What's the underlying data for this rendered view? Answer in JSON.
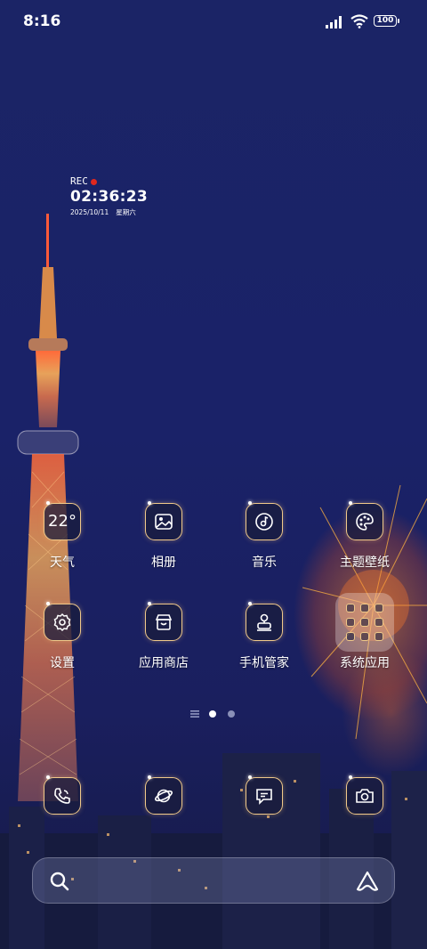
{
  "status_bar": {
    "time": "8:16",
    "battery": "100"
  },
  "widget": {
    "rec": "REC",
    "time": "02:36:23",
    "date": "2025/10/11",
    "weekday": "星期六"
  },
  "weather": {
    "temp": "22°"
  },
  "apps_row1": [
    {
      "label": "天气",
      "icon": "weather-icon"
    },
    {
      "label": "相册",
      "icon": "gallery-icon"
    },
    {
      "label": "音乐",
      "icon": "music-icon"
    },
    {
      "label": "主题壁纸",
      "icon": "palette-icon"
    }
  ],
  "apps_row2": [
    {
      "label": "设置",
      "icon": "gear-icon"
    },
    {
      "label": "应用商店",
      "icon": "store-icon"
    },
    {
      "label": "手机管家",
      "icon": "phone-manager-icon"
    },
    {
      "label": "系统应用",
      "icon": "folder-icon"
    }
  ],
  "dock": [
    {
      "icon": "phone-icon"
    },
    {
      "icon": "browser-planet-icon"
    },
    {
      "icon": "message-icon"
    },
    {
      "icon": "camera-icon"
    }
  ],
  "pages": {
    "count": 2,
    "current": 1
  },
  "colors": {
    "accent": "#f0c98a",
    "background": "#1b2466"
  }
}
